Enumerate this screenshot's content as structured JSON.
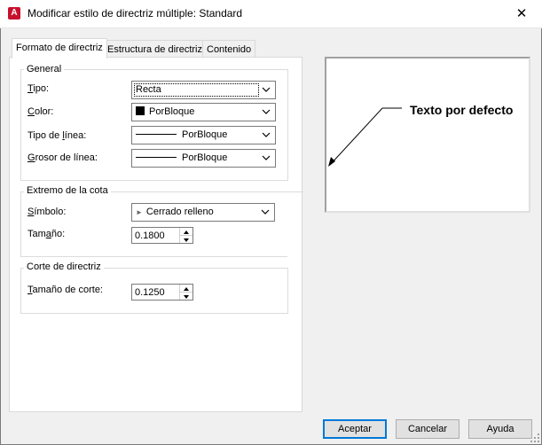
{
  "window": {
    "title": "Modificar estilo de directriz múltiple: Standard",
    "app_icon": "autocad-icon",
    "app_icon_letter": "A",
    "close_glyph": "✕"
  },
  "tabs": [
    {
      "label": "Formato de directriz",
      "active": true
    },
    {
      "label": "Estructura de directriz",
      "active": false
    },
    {
      "label": "Contenido",
      "active": false
    }
  ],
  "general": {
    "title": "General",
    "tipo": {
      "label_pre": "",
      "label_u": "T",
      "label_post": "ipo:",
      "value": "Recta"
    },
    "color": {
      "label_pre": "",
      "label_u": "C",
      "label_post": "olor:",
      "value": "PorBloque",
      "swatch": "#000000"
    },
    "tipo_linea": {
      "label_pre": "Tipo de ",
      "label_u": "l",
      "label_post": "ínea:",
      "value": "PorBloque"
    },
    "grosor_linea": {
      "label_pre": "",
      "label_u": "G",
      "label_post": "rosor de línea:",
      "value": "PorBloque"
    }
  },
  "extremo": {
    "title": "Extremo de la cota",
    "simbolo": {
      "label_pre": "",
      "label_u": "S",
      "label_post": "ímbolo:",
      "value": "Cerrado relleno",
      "arrow_glyph": "►"
    },
    "tamano": {
      "label_pre": "Tam",
      "label_u": "a",
      "label_post": "ño:",
      "value": "0.1800"
    }
  },
  "corte": {
    "title": "Corte de directriz",
    "tamano_corte": {
      "label_pre": "",
      "label_u": "T",
      "label_post": "amaño de corte:",
      "value": "0.1250"
    }
  },
  "preview": {
    "text": "Texto por defecto"
  },
  "buttons": {
    "ok": "Aceptar",
    "cancel": "Cancelar",
    "help": "Ayuda"
  },
  "colors": {
    "accent": "#0078d7",
    "app_icon_bg": "#c8102e"
  }
}
